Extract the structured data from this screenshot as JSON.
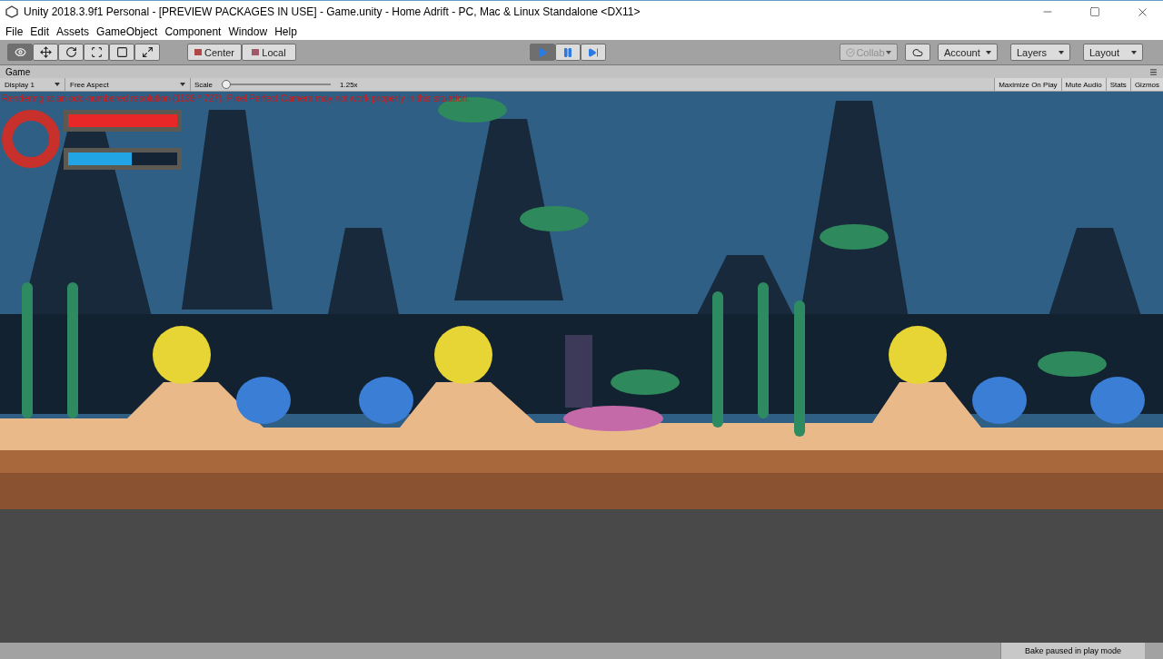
{
  "window": {
    "title": "Unity 2018.3.9f1 Personal - [PREVIEW PACKAGES IN USE] - Game.unity - Home Adrift - PC, Mac & Linux Standalone <DX11>"
  },
  "menu": [
    "File",
    "Edit",
    "Assets",
    "GameObject",
    "Component",
    "Window",
    "Help"
  ],
  "toolbar": {
    "tools": [
      {
        "kind": "view",
        "selected": true
      },
      {
        "kind": "move",
        "selected": false
      },
      {
        "kind": "rotate",
        "selected": false
      },
      {
        "kind": "scale",
        "selected": false
      },
      {
        "kind": "rect",
        "selected": false
      },
      {
        "kind": "transform",
        "selected": false
      }
    ],
    "pivot": [
      {
        "kind": "center",
        "label": "Center"
      },
      {
        "kind": "local",
        "label": "Local"
      }
    ],
    "playback": [
      {
        "kind": "play",
        "selected": true
      },
      {
        "kind": "pause",
        "selected": false
      },
      {
        "kind": "step",
        "selected": false
      }
    ],
    "collab": {
      "label": "Collab",
      "disabled": true
    },
    "dropdowns": [
      "Account",
      "Layers",
      "Layout"
    ]
  },
  "game_panel": {
    "tab": "Game",
    "display": "Display 1",
    "aspect": "Free Aspect",
    "scale": {
      "label": "Scale",
      "level": 0.0,
      "reading": "1.25x"
    },
    "toggles": [
      {
        "label": "Maximize On Play",
        "selected": false
      },
      {
        "label": "Mute Audio",
        "selected": false
      },
      {
        "label": "Stats",
        "selected": false
      },
      {
        "label": "Gizmos",
        "selected": false
      }
    ],
    "warning": "Rendering at an odd-numbered resolution (1139 * 727). Pixel Perfect Camera may not work properly in this situation.",
    "hud": [
      {
        "kind": "health",
        "level": 1.0
      },
      {
        "kind": "oxygen",
        "level": 0.58
      }
    ]
  },
  "status_bar": {
    "message": "Bake paused in play mode"
  }
}
